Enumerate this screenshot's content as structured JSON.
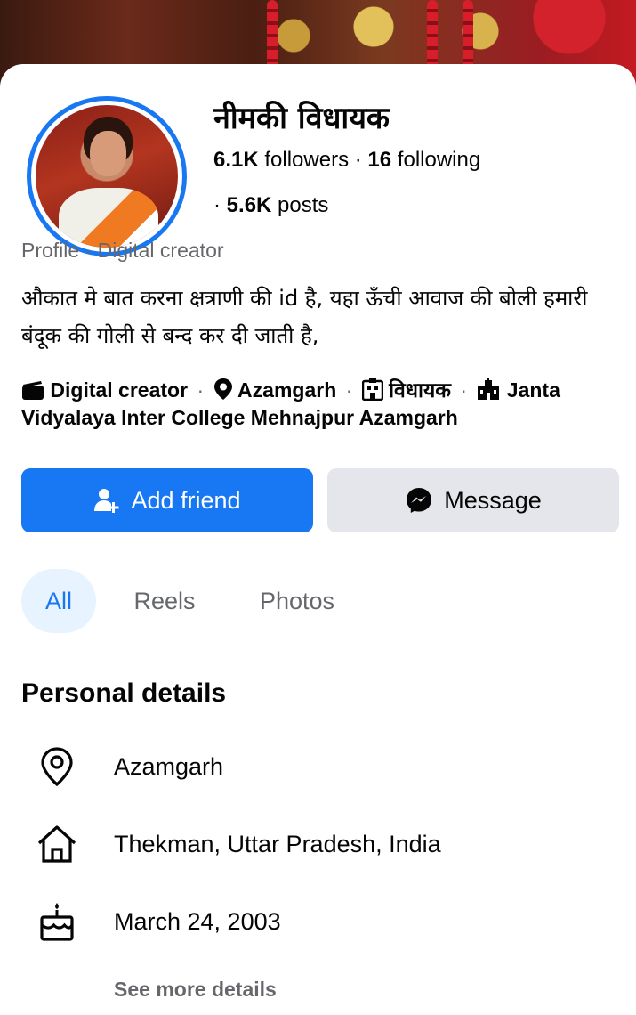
{
  "profile": {
    "name": "नीमकी विधायक",
    "followers_count": "6.1K",
    "followers_label": "followers",
    "following_count": "16",
    "following_label": "following",
    "posts_count": "5.6K",
    "posts_label": "posts",
    "category_line": "Profile · Digital creator",
    "bio": "औकात मे बात करना क्षत्राणी की id है, यहा ऊँची आवाज की बोली हमारी बंदूक की गोली से बन्द कर दी जाती है,"
  },
  "meta": {
    "creator": "Digital creator",
    "location": "Azamgarh",
    "role": "विधायक",
    "school": "Janta Vidyalaya Inter College Mehnajpur Azamgarh"
  },
  "actions": {
    "add_friend": "Add friend",
    "message": "Message"
  },
  "tabs": [
    "All",
    "Reels",
    "Photos"
  ],
  "personal_details": {
    "title": "Personal details",
    "items": [
      {
        "icon": "location-pin-icon",
        "text": "Azamgarh"
      },
      {
        "icon": "home-icon",
        "text": "Thekman, Uttar Pradesh, India"
      },
      {
        "icon": "birthday-cake-icon",
        "text": "March 24, 2003"
      }
    ],
    "see_more": "See more details"
  },
  "colors": {
    "accent": "#1877f2",
    "secondary_button": "#e4e6eb",
    "muted_text": "#65676b",
    "active_tab_bg": "#e7f3ff"
  }
}
